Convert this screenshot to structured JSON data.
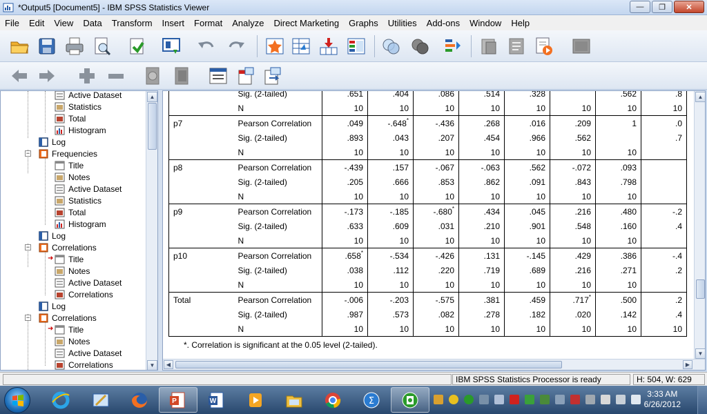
{
  "window": {
    "title": "*Output5 [Document5] - IBM SPSS Statistics Viewer",
    "controls": [
      "minimize",
      "maximize",
      "close"
    ]
  },
  "menubar": {
    "items": [
      {
        "label": "File"
      },
      {
        "label": "Edit"
      },
      {
        "label": "View"
      },
      {
        "label": "Data"
      },
      {
        "label": "Transform"
      },
      {
        "label": "Insert"
      },
      {
        "label": "Format"
      },
      {
        "label": "Analyze"
      },
      {
        "label": "Direct Marketing"
      },
      {
        "label": "Graphs"
      },
      {
        "label": "Utilities"
      },
      {
        "label": "Add-ons"
      },
      {
        "label": "Window"
      },
      {
        "label": "Help"
      }
    ]
  },
  "toolbar1": {
    "icons": [
      "open-icon",
      "save-icon",
      "print-icon",
      "print-preview-icon",
      "export-icon",
      "recall-dialog-icon",
      "undo-icon",
      "redo-icon",
      "goto-case-icon",
      "goto-data-icon",
      "goto-variable-icon",
      "variables-icon",
      "select-cases-icon",
      "weight-cases-icon",
      "value-labels-icon",
      "designate-window-icon",
      "output-document-icon",
      "script-icon",
      "run-script-icon",
      "empty-icon"
    ]
  },
  "toolbar2": {
    "icons": [
      "promote-icon",
      "demote-icon",
      "expand-icon",
      "collapse-icon",
      "show-icon",
      "hide-icon",
      "insert-heading-icon",
      "insert-title-icon",
      "insert-text-icon"
    ]
  },
  "outline": {
    "items": [
      {
        "label": "Active Dataset",
        "icon": "active-dataset-icon",
        "indent": 2
      },
      {
        "label": "Statistics",
        "icon": "statistics-table-icon",
        "indent": 2
      },
      {
        "label": "Total",
        "icon": "table-icon",
        "indent": 2
      },
      {
        "label": "Histogram",
        "icon": "histogram-icon",
        "indent": 2
      },
      {
        "label": "Log",
        "icon": "log-icon",
        "indent": 1
      },
      {
        "label": "Frequencies",
        "icon": "book-icon",
        "indent": 1,
        "expanded": true
      },
      {
        "label": "Title",
        "icon": "title-icon",
        "indent": 2
      },
      {
        "label": "Notes",
        "icon": "notes-icon",
        "indent": 2
      },
      {
        "label": "Active Dataset",
        "icon": "active-dataset-icon",
        "indent": 2
      },
      {
        "label": "Statistics",
        "icon": "statistics-table-icon",
        "indent": 2
      },
      {
        "label": "Total",
        "icon": "table-icon",
        "indent": 2
      },
      {
        "label": "Histogram",
        "icon": "histogram-icon",
        "indent": 2
      },
      {
        "label": "Log",
        "icon": "log-icon",
        "indent": 1
      },
      {
        "label": "Correlations",
        "icon": "book-icon",
        "indent": 1,
        "expanded": true
      },
      {
        "label": "Title",
        "icon": "title-icon",
        "indent": 2,
        "marked": true
      },
      {
        "label": "Notes",
        "icon": "notes-icon",
        "indent": 2
      },
      {
        "label": "Active Dataset",
        "icon": "active-dataset-icon",
        "indent": 2
      },
      {
        "label": "Correlations",
        "icon": "table-icon",
        "indent": 2
      },
      {
        "label": "Log",
        "icon": "log-icon",
        "indent": 1
      },
      {
        "label": "Correlations",
        "icon": "book-icon",
        "indent": 1,
        "expanded": true
      },
      {
        "label": "Title",
        "icon": "title-icon",
        "indent": 2,
        "marked": true
      },
      {
        "label": "Notes",
        "icon": "notes-icon",
        "indent": 2
      },
      {
        "label": "Active Dataset",
        "icon": "active-dataset-icon",
        "indent": 2
      },
      {
        "label": "Correlations",
        "icon": "table-icon",
        "indent": 2
      }
    ]
  },
  "table": {
    "rows": [
      {
        "var": "",
        "stat": "Sig. (2-tailed)",
        "cells": [
          ".651",
          ".404",
          ".086",
          ".514",
          ".328",
          "",
          ".562",
          ".8"
        ]
      },
      {
        "var": "",
        "stat": "N",
        "cells": [
          "10",
          "10",
          "10",
          "10",
          "10",
          "10",
          "10",
          "10"
        ],
        "end": true
      },
      {
        "var": "p7",
        "stat": "Pearson Correlation",
        "cells": [
          ".049",
          "-.648*",
          "-.436",
          ".268",
          ".016",
          ".209",
          "1",
          ".0"
        ]
      },
      {
        "var": "",
        "stat": "Sig. (2-tailed)",
        "cells": [
          ".893",
          ".043",
          ".207",
          ".454",
          ".966",
          ".562",
          "",
          ".7"
        ]
      },
      {
        "var": "",
        "stat": "N",
        "cells": [
          "10",
          "10",
          "10",
          "10",
          "10",
          "10",
          "10",
          ""
        ],
        "end": true
      },
      {
        "var": "p8",
        "stat": "Pearson Correlation",
        "cells": [
          "-.439",
          ".157",
          "-.067",
          "-.063",
          ".562",
          "-.072",
          ".093",
          ""
        ]
      },
      {
        "var": "",
        "stat": "Sig. (2-tailed)",
        "cells": [
          ".205",
          ".666",
          ".853",
          ".862",
          ".091",
          ".843",
          ".798",
          ""
        ]
      },
      {
        "var": "",
        "stat": "N",
        "cells": [
          "10",
          "10",
          "10",
          "10",
          "10",
          "10",
          "10",
          ""
        ],
        "end": true
      },
      {
        "var": "p9",
        "stat": "Pearson Correlation",
        "cells": [
          "-.173",
          "-.185",
          "-.680*",
          ".434",
          ".045",
          ".216",
          ".480",
          "-.2"
        ]
      },
      {
        "var": "",
        "stat": "Sig. (2-tailed)",
        "cells": [
          ".633",
          ".609",
          ".031",
          ".210",
          ".901",
          ".548",
          ".160",
          ".4"
        ]
      },
      {
        "var": "",
        "stat": "N",
        "cells": [
          "10",
          "10",
          "10",
          "10",
          "10",
          "10",
          "10",
          ""
        ],
        "end": true
      },
      {
        "var": "p10",
        "stat": "Pearson Correlation",
        "cells": [
          ".658*",
          "-.534",
          "-.426",
          ".131",
          "-.145",
          ".429",
          ".386",
          "-.4"
        ]
      },
      {
        "var": "",
        "stat": "Sig. (2-tailed)",
        "cells": [
          ".038",
          ".112",
          ".220",
          ".719",
          ".689",
          ".216",
          ".271",
          ".2"
        ]
      },
      {
        "var": "",
        "stat": "N",
        "cells": [
          "10",
          "10",
          "10",
          "10",
          "10",
          "10",
          "10",
          ""
        ],
        "end": true
      },
      {
        "var": "Total",
        "stat": "Pearson Correlation",
        "cells": [
          "-.006",
          "-.203",
          "-.575",
          ".381",
          ".459",
          ".717*",
          ".500",
          ".2"
        ]
      },
      {
        "var": "",
        "stat": "Sig. (2-tailed)",
        "cells": [
          ".987",
          ".573",
          ".082",
          ".278",
          ".182",
          ".020",
          ".142",
          ".4"
        ]
      },
      {
        "var": "",
        "stat": "N",
        "cells": [
          "10",
          "10",
          "10",
          "10",
          "10",
          "10",
          "10",
          "10"
        ],
        "end": true
      }
    ],
    "footnote": "*. Correlation is significant at the 0.05 level (2-tailed)."
  },
  "statusbar": {
    "processor": "IBM SPSS Statistics Processor is ready",
    "dimensions": "H: 504, W: 629 pt."
  },
  "taskbar": {
    "apps": [
      "ie-icon",
      "paint-icon",
      "firefox-icon",
      "powerpoint-icon",
      "word-icon",
      "media-player-icon",
      "explorer-icon",
      "chrome-icon",
      "sigma-icon",
      "spss-icon"
    ],
    "active_app": "powerpoint-icon",
    "clock_time": "3:33 AM",
    "clock_date": "6/26/2012"
  },
  "colors": {
    "titlebar": "#c3d6ef",
    "taskbar": "#28476d",
    "accent": "#1e6fb9"
  }
}
